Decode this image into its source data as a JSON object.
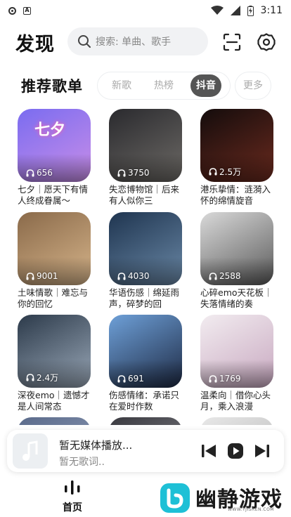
{
  "status_bar": {
    "time": "3:11",
    "notif_icon_1": "circle-dot-icon",
    "notif_icon_2": "a-box-icon"
  },
  "header": {
    "title": "发现",
    "search_placeholder": "搜索: 单曲、歌手",
    "scan_icon": "scan-icon",
    "settings_icon": "gear-icon"
  },
  "section": {
    "title": "推荐歌单",
    "tabs": [
      {
        "label": "新歌",
        "active": false
      },
      {
        "label": "热榜",
        "active": false
      },
      {
        "label": "抖音",
        "active": true
      }
    ],
    "more_label": "更多"
  },
  "playlists": [
    {
      "title": "七夕｜愿天下有情人终成眷属～",
      "plays": "656",
      "cover_text": "七夕",
      "colors": [
        "#7a6cf0",
        "#c98ee8"
      ]
    },
    {
      "title": "失恋博物馆｜后来有人似你三",
      "plays": "3750",
      "colors": [
        "#2a2a2e",
        "#6d6a66"
      ]
    },
    {
      "title": "港乐挚情：涟漪入怀的绵情旋音",
      "plays": "2.5万",
      "colors": [
        "#140c0c",
        "#6b2a1e"
      ]
    },
    {
      "title": "土味情歌｜难忘与你的回忆",
      "plays": "9001",
      "colors": [
        "#8a6a4a",
        "#d6b48a"
      ]
    },
    {
      "title": "华语伤感｜绵延雨声，碎梦的回",
      "plays": "4030",
      "colors": [
        "#1f3550",
        "#6a88a6"
      ]
    },
    {
      "title": "心碎emo天花板｜失落情绪的奏",
      "plays": "2588",
      "colors": [
        "#d9d9d9",
        "#5a5a5a"
      ]
    },
    {
      "title": "深夜emo｜遗憾才是人间常态",
      "plays": "2.4万",
      "colors": [
        "#2c3a4a",
        "#9aa8b8"
      ]
    },
    {
      "title": "伤感情绪：承诺只在爱时作数",
      "plays": "691",
      "colors": [
        "#6ea0d8",
        "#1e2a44"
      ]
    },
    {
      "title": "温柔向｜借你心头月，乘入浪漫",
      "plays": "1769",
      "colors": [
        "#f2ecf0",
        "#c8a8c0"
      ]
    },
    {
      "title": "",
      "plays": "",
      "colors": [
        "#5a6a8a",
        "#9aa6c0"
      ]
    },
    {
      "title": "",
      "plays": "",
      "colors": [
        "#3a3a40",
        "#8a8a90"
      ]
    },
    {
      "title": "",
      "plays": "",
      "colors": [
        "#e8e8e8",
        "#b0b0b0"
      ]
    }
  ],
  "player": {
    "title": "暂无媒体播放...",
    "subtitle": "暂无歌词..",
    "prev_icon": "skip-previous-icon",
    "play_icon": "play-icon",
    "next_icon": "skip-next-icon"
  },
  "nav": {
    "home_label": "首页",
    "home_icon": "sound-bars-icon"
  },
  "watermark": {
    "text": "幽静游戏",
    "url": "WWW.YJISREN.COM"
  }
}
